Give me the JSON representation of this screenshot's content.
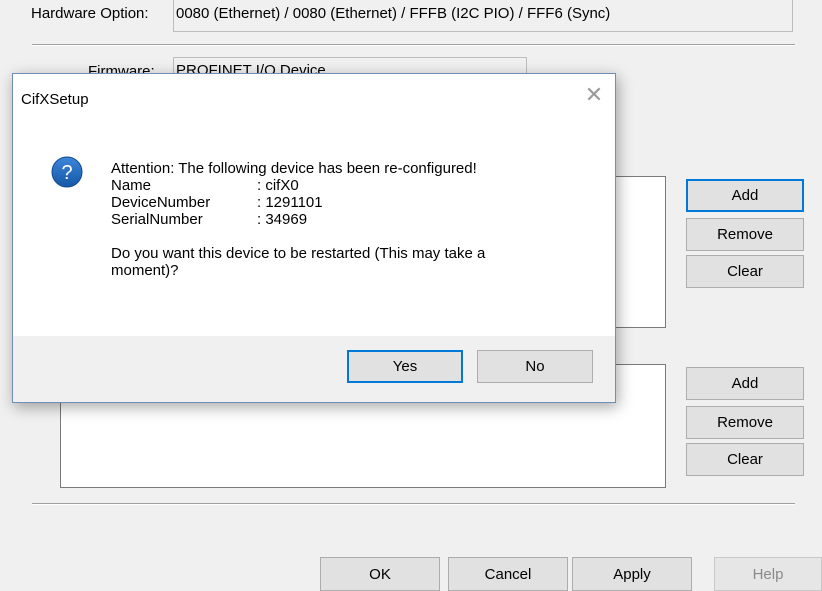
{
  "background": {
    "hardware_option_label": "Hardware Option:",
    "hardware_option_value": "0080 (Ethernet) / 0080 (Ethernet) / FFFB (I2C PIO) / FFF6 (Sync)",
    "firmware_label": "Firmware:",
    "firmware_value": "PROFINET I/O Device",
    "group1_buttons": {
      "add": "Add",
      "remove": "Remove",
      "clear": "Clear"
    },
    "group2_buttons": {
      "add": "Add",
      "remove": "Remove",
      "clear": "Clear"
    },
    "footer_buttons": {
      "ok": "OK",
      "cancel": "Cancel",
      "apply": "Apply",
      "help": "Help"
    }
  },
  "dialog": {
    "title": "CifXSetup",
    "close_glyph": "✕",
    "icon": "question-icon",
    "icon_glyph": "?",
    "heading": "Attention: The following device has been re-configured!",
    "fields": [
      {
        "key": "Name",
        "value": ": cifX0"
      },
      {
        "key": "DeviceNumber",
        "value": ": 1291101"
      },
      {
        "key": "SerialNumber",
        "value": ": 34969"
      }
    ],
    "question_line1": "Do you want this device to be restarted (This may take a",
    "question_line2": "moment)?",
    "yes_label": "Yes",
    "no_label": "No"
  },
  "colors": {
    "accent": "#0078d7",
    "question_icon": "#1f66b5"
  }
}
